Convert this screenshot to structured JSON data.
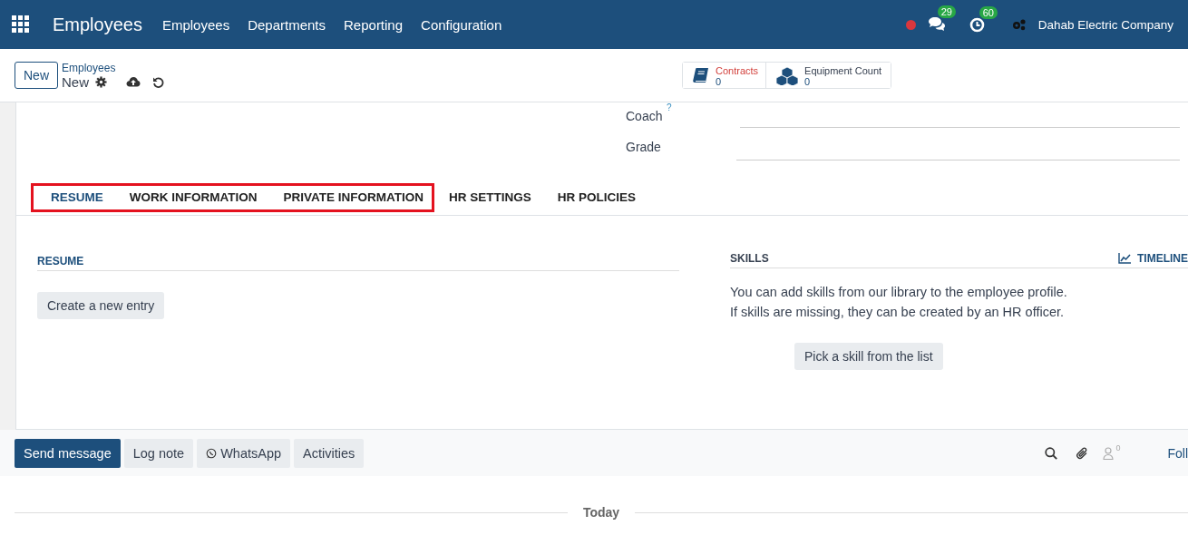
{
  "navbar": {
    "app_name": "Employees",
    "menu": [
      "Employees",
      "Departments",
      "Reporting",
      "Configuration"
    ],
    "messages_count": "29",
    "activities_count": "60",
    "company": "Dahab Electric Company"
  },
  "control_panel": {
    "new_button": "New",
    "breadcrumb": "Employees",
    "record": "New",
    "smart_buttons": [
      {
        "kind": "book",
        "label": "Contracts",
        "value": "0",
        "color": "#d23f3a"
      },
      {
        "kind": "cubes",
        "label": "Equipment Count",
        "value": "0",
        "color": "#374151"
      }
    ]
  },
  "fields": [
    {
      "label": "Coach",
      "help": "?"
    },
    {
      "label": "Grade"
    }
  ],
  "tabs": [
    {
      "label": "RESUME",
      "selected": true,
      "highlighted": true
    },
    {
      "label": "WORK INFORMATION",
      "selected": false,
      "highlighted": true
    },
    {
      "label": "PRIVATE INFORMATION",
      "selected": false,
      "highlighted": true
    },
    {
      "label": "HR SETTINGS",
      "selected": false,
      "highlighted": false
    },
    {
      "label": "HR POLICIES",
      "selected": false,
      "highlighted": false
    }
  ],
  "resume": {
    "title": "RESUME",
    "button": "Create a new entry"
  },
  "skills": {
    "title": "SKILLS",
    "timeline": "TIMELINE",
    "lines": [
      "You can add skills from our library to the employee profile.",
      "If skills are missing, they can be created by an HR officer."
    ],
    "button": "Pick a skill from the list"
  },
  "chatter": {
    "buttons": [
      {
        "kind": "primary",
        "label": "Send message"
      },
      {
        "kind": "secondary",
        "label": "Log note"
      },
      {
        "kind": "whatsapp",
        "label": "WhatsApp"
      },
      {
        "kind": "secondary",
        "label": "Activities"
      }
    ],
    "followers_count": "0",
    "follow": "Foll",
    "date_separator": "Today"
  }
}
